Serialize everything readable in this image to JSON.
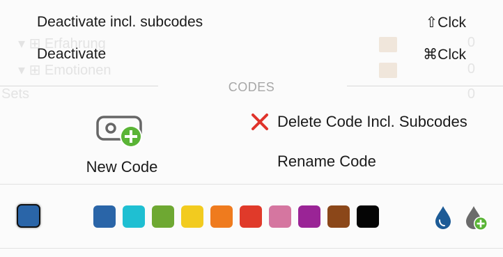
{
  "menu": {
    "items": [
      {
        "label": "Deactivate incl. subcodes",
        "shortcut": "⇧Clck"
      },
      {
        "label": "Deactivate",
        "shortcut": "⌘Clck"
      }
    ]
  },
  "section": {
    "title": "CODES"
  },
  "new_code": {
    "label": "New Code"
  },
  "actions": {
    "delete_label": "Delete Code Incl. Subcodes",
    "rename_label": "Rename Code"
  },
  "colors": {
    "selected": "#2a65a8",
    "palette": [
      "#2a65a8",
      "#1fbfd2",
      "#6ea832",
      "#f2cb1f",
      "#ef7b1e",
      "#e03a2a",
      "#d576a0",
      "#9a2496",
      "#8b4719",
      "#050505"
    ],
    "accent_green": "#5ab436",
    "delete_red": "#e0332b",
    "drop_blue": "#1d5b96",
    "drop_gray": "#6b6b6b"
  }
}
